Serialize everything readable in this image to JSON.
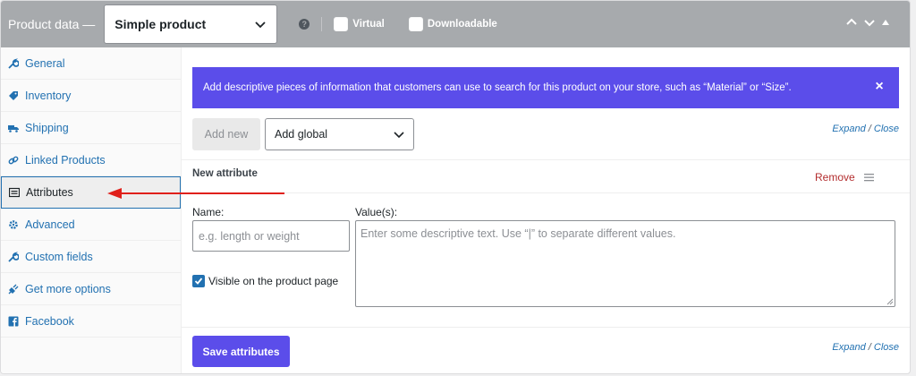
{
  "header": {
    "title": "Product data —",
    "product_type": "Simple product",
    "virtual_label": "Virtual",
    "downloadable_label": "Downloadable",
    "help_glyph": "?"
  },
  "sidebar": {
    "items": [
      {
        "label": "General",
        "icon": "wrench-icon"
      },
      {
        "label": "Inventory",
        "icon": "tag-icon"
      },
      {
        "label": "Shipping",
        "icon": "truck-icon"
      },
      {
        "label": "Linked Products",
        "icon": "link-icon"
      },
      {
        "label": "Attributes",
        "icon": "list-icon",
        "active": true
      },
      {
        "label": "Advanced",
        "icon": "gear-icon"
      },
      {
        "label": "Custom fields",
        "icon": "wrench-icon"
      },
      {
        "label": "Get more options",
        "icon": "plugin-icon"
      },
      {
        "label": "Facebook",
        "icon": "facebook-icon"
      }
    ]
  },
  "notice": {
    "text": "Add descriptive pieces of information that customers can use to search for this product on your store, such as “Material” or “Size”.",
    "close": "×"
  },
  "toolbar": {
    "add_new": "Add new",
    "add_global": "Add global",
    "expand": "Expand",
    "slash": " / ",
    "close": "Close"
  },
  "attribute": {
    "title": "New attribute",
    "remove": "Remove",
    "name_label": "Name:",
    "name_placeholder": "e.g. length or weight",
    "values_label": "Value(s):",
    "values_placeholder": "Enter some descriptive text. Use “|” to separate different values.",
    "visible_label": "Visible on the product page",
    "visible_checked": true
  },
  "footer": {
    "save": "Save attributes",
    "expand": "Expand",
    "slash": " / ",
    "close": "Close"
  },
  "colors": {
    "accent": "#5b4dea",
    "link": "#2271b1",
    "header_bg": "#a7aaad",
    "remove": "#b32d2e",
    "arrow": "#e0201b"
  }
}
